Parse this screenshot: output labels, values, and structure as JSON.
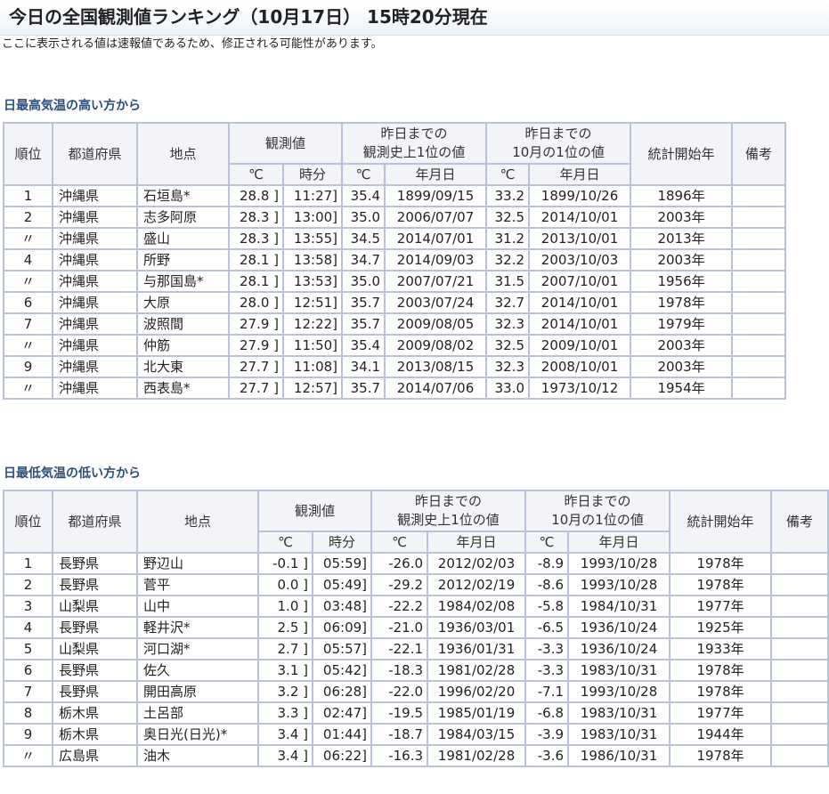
{
  "page": {
    "title": "今日の全国観測値ランキング（10月17日） 15時20分現在",
    "notice": "ここに表示される値は速報値であるため、修正される可能性があります。"
  },
  "headers": {
    "rank": "順位",
    "pref": "都道府県",
    "point": "地点",
    "obs": "観測値",
    "hist": "昨日までの\n観測史上1位の値",
    "month": "昨日までの\n10月の1位の値",
    "start": "統計開始年",
    "note": "備考",
    "celsius": "℃",
    "time": "時分",
    "date": "年月日"
  },
  "tables": [
    {
      "heading": "日最高気温の高い方から",
      "rows": [
        {
          "rank": "1",
          "pref": "沖縄県",
          "point": "石垣島*",
          "val": "28.8 ]",
          "time": "11:27]",
          "hist_val": "35.4",
          "hist_date": "1899/09/15",
          "mon_val": "33.2",
          "mon_date": "1899/10/26",
          "start": "1896年",
          "note": ""
        },
        {
          "rank": "2",
          "pref": "沖縄県",
          "point": "志多阿原",
          "val": "28.3 ]",
          "time": "13:00]",
          "hist_val": "35.0",
          "hist_date": "2006/07/07",
          "mon_val": "32.5",
          "mon_date": "2014/10/01",
          "start": "2003年",
          "note": ""
        },
        {
          "rank": "〃",
          "pref": "沖縄県",
          "point": "盛山",
          "val": "28.3 ]",
          "time": "13:55]",
          "hist_val": "34.5",
          "hist_date": "2014/07/01",
          "mon_val": "31.2",
          "mon_date": "2013/10/01",
          "start": "2013年",
          "note": ""
        },
        {
          "rank": "4",
          "pref": "沖縄県",
          "point": "所野",
          "val": "28.1 ]",
          "time": "13:58]",
          "hist_val": "34.7",
          "hist_date": "2014/09/03",
          "mon_val": "32.2",
          "mon_date": "2003/10/03",
          "start": "2003年",
          "note": ""
        },
        {
          "rank": "〃",
          "pref": "沖縄県",
          "point": "与那国島*",
          "val": "28.1 ]",
          "time": "13:53]",
          "hist_val": "35.0",
          "hist_date": "2007/07/21",
          "mon_val": "31.5",
          "mon_date": "2007/10/01",
          "start": "1956年",
          "note": ""
        },
        {
          "rank": "6",
          "pref": "沖縄県",
          "point": "大原",
          "val": "28.0 ]",
          "time": "12:51]",
          "hist_val": "35.7",
          "hist_date": "2003/07/24",
          "mon_val": "32.7",
          "mon_date": "2014/10/01",
          "start": "1978年",
          "note": ""
        },
        {
          "rank": "7",
          "pref": "沖縄県",
          "point": "波照間",
          "val": "27.9 ]",
          "time": "12:22]",
          "hist_val": "35.7",
          "hist_date": "2009/08/05",
          "mon_val": "32.3",
          "mon_date": "2014/10/01",
          "start": "1979年",
          "note": ""
        },
        {
          "rank": "〃",
          "pref": "沖縄県",
          "point": "仲筋",
          "val": "27.9 ]",
          "time": "11:50]",
          "hist_val": "35.4",
          "hist_date": "2009/08/02",
          "mon_val": "32.5",
          "mon_date": "2009/10/01",
          "start": "2003年",
          "note": ""
        },
        {
          "rank": "9",
          "pref": "沖縄県",
          "point": "北大東",
          "val": "27.7 ]",
          "time": "11:08]",
          "hist_val": "34.1",
          "hist_date": "2013/08/15",
          "mon_val": "32.3",
          "mon_date": "2008/10/01",
          "start": "2003年",
          "note": ""
        },
        {
          "rank": "〃",
          "pref": "沖縄県",
          "point": "西表島*",
          "val": "27.7 ]",
          "time": "12:57]",
          "hist_val": "35.7",
          "hist_date": "2014/07/06",
          "mon_val": "33.0",
          "mon_date": "1973/10/12",
          "start": "1954年",
          "note": ""
        }
      ]
    },
    {
      "heading": "日最低気温の低い方から",
      "rows": [
        {
          "rank": "1",
          "pref": "長野県",
          "point": "野辺山",
          "val": "-0.1 ]",
          "time": "05:59]",
          "hist_val": "-26.0",
          "hist_date": "2012/02/03",
          "mon_val": "-8.9",
          "mon_date": "1993/10/28",
          "start": "1978年",
          "note": ""
        },
        {
          "rank": "2",
          "pref": "長野県",
          "point": "菅平",
          "val": "0.0 ]",
          "time": "05:49]",
          "hist_val": "-29.2",
          "hist_date": "2012/02/19",
          "mon_val": "-8.6",
          "mon_date": "1993/10/28",
          "start": "1978年",
          "note": ""
        },
        {
          "rank": "3",
          "pref": "山梨県",
          "point": "山中",
          "val": "1.0 ]",
          "time": "03:48]",
          "hist_val": "-22.2",
          "hist_date": "1984/02/08",
          "mon_val": "-5.8",
          "mon_date": "1984/10/31",
          "start": "1977年",
          "note": ""
        },
        {
          "rank": "4",
          "pref": "長野県",
          "point": "軽井沢*",
          "val": "2.5 ]",
          "time": "06:09]",
          "hist_val": "-21.0",
          "hist_date": "1936/03/01",
          "mon_val": "-6.5",
          "mon_date": "1936/10/24",
          "start": "1925年",
          "note": ""
        },
        {
          "rank": "5",
          "pref": "山梨県",
          "point": "河口湖*",
          "val": "2.7 ]",
          "time": "05:57]",
          "hist_val": "-22.1",
          "hist_date": "1936/01/31",
          "mon_val": "-3.3",
          "mon_date": "1936/10/24",
          "start": "1933年",
          "note": ""
        },
        {
          "rank": "6",
          "pref": "長野県",
          "point": "佐久",
          "val": "3.1 ]",
          "time": "05:42]",
          "hist_val": "-18.3",
          "hist_date": "1981/02/28",
          "mon_val": "-3.3",
          "mon_date": "1983/10/31",
          "start": "1978年",
          "note": ""
        },
        {
          "rank": "7",
          "pref": "長野県",
          "point": "開田高原",
          "val": "3.2 ]",
          "time": "06:28]",
          "hist_val": "-22.0",
          "hist_date": "1996/02/20",
          "mon_val": "-7.1",
          "mon_date": "1993/10/28",
          "start": "1978年",
          "note": ""
        },
        {
          "rank": "8",
          "pref": "栃木県",
          "point": "土呂部",
          "val": "3.3 ]",
          "time": "02:47]",
          "hist_val": "-19.5",
          "hist_date": "1985/01/19",
          "mon_val": "-6.8",
          "mon_date": "1983/10/31",
          "start": "1977年",
          "note": ""
        },
        {
          "rank": "9",
          "pref": "栃木県",
          "point": "奥日光(日光)*",
          "val": "3.4 ]",
          "time": "01:44]",
          "hist_val": "-18.7",
          "hist_date": "1984/03/15",
          "mon_val": "-3.9",
          "mon_date": "1983/10/31",
          "start": "1944年",
          "note": ""
        },
        {
          "rank": "〃",
          "pref": "広島県",
          "point": "油木",
          "val": "3.4 ]",
          "time": "06:22]",
          "hist_val": "-16.3",
          "hist_date": "1981/02/28",
          "mon_val": "-3.6",
          "mon_date": "1986/10/31",
          "start": "1978年",
          "note": ""
        }
      ]
    }
  ]
}
